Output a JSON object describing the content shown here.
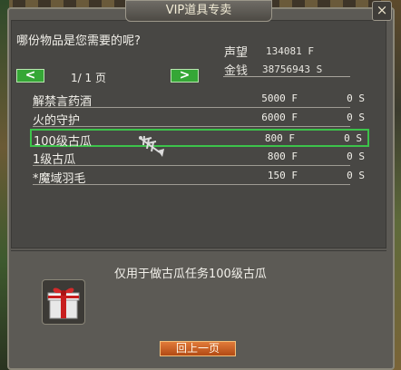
{
  "window": {
    "title": "VIP道具专卖",
    "close_label": "×"
  },
  "prompt": "哪份物品是您需要的呢?",
  "stats": {
    "reputation_label": "声望",
    "reputation_value": "134081 F",
    "money_label": "金钱",
    "money_value": "38756943 S"
  },
  "pager": {
    "prev_label": "<",
    "next_label": ">",
    "indicator": "1/ 1 页"
  },
  "items": [
    {
      "name": "解禁言药酒",
      "price": "5000 F",
      "spoints": "0 S"
    },
    {
      "name": "火的守护",
      "price": "6000 F",
      "spoints": "0 S"
    },
    {
      "name": "100级古瓜",
      "price": "800 F",
      "spoints": "0 S",
      "selected": true
    },
    {
      "name": "1级古瓜",
      "price": "800 F",
      "spoints": "0 S"
    },
    {
      "name": "*魔域羽毛",
      "price": "150 F",
      "spoints": "0 S"
    }
  ],
  "detail": {
    "description": "仅用于做古瓜任务100级古瓜",
    "icon": "gift-box-icon"
  },
  "footer": {
    "back_label": "回上一页"
  },
  "colors": {
    "accent_green": "#3cc34a",
    "button_orange": "#c95a1f",
    "panel_bg": "#484744"
  }
}
